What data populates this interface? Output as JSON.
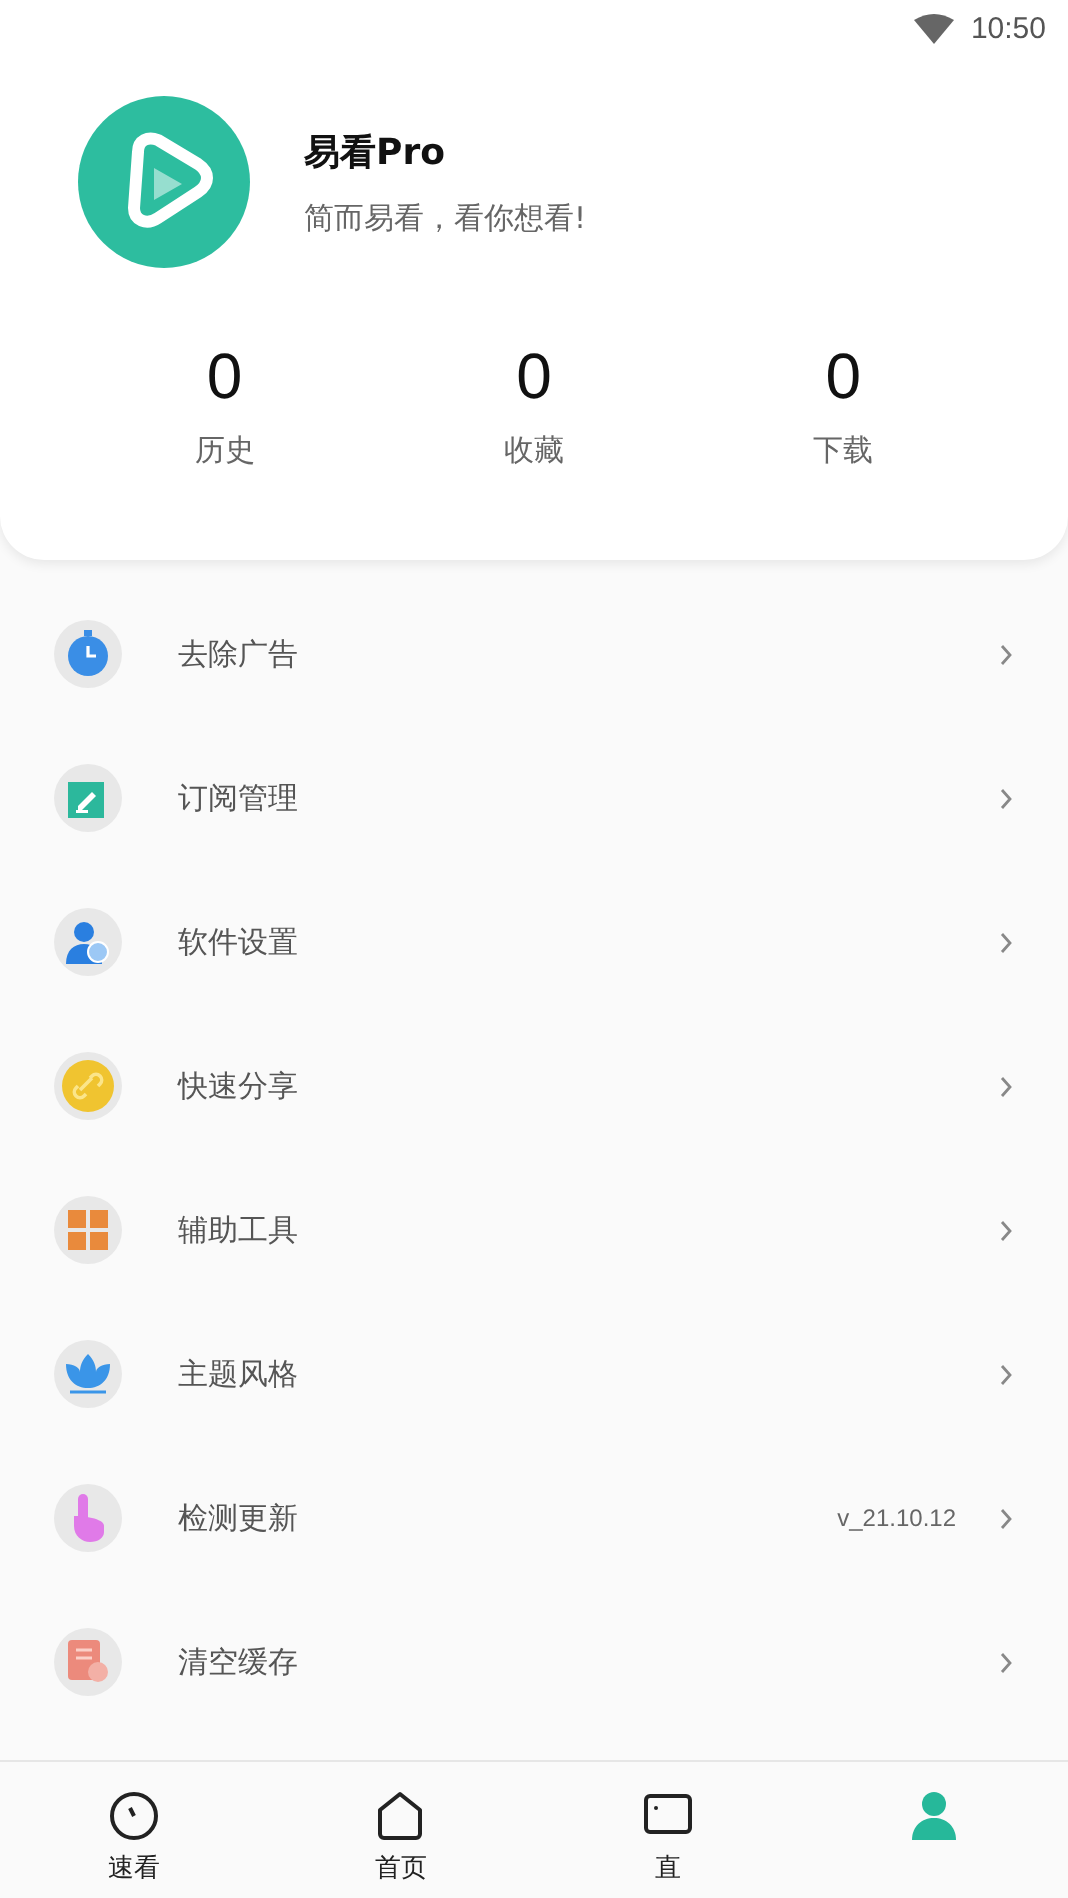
{
  "status_bar": {
    "time": "10:50"
  },
  "profile": {
    "name": "易看Pro",
    "slogan": "简而易看，看你想看!"
  },
  "stats": [
    {
      "value": "0",
      "label": "历史"
    },
    {
      "value": "0",
      "label": "收藏"
    },
    {
      "value": "0",
      "label": "下载"
    }
  ],
  "menu": [
    {
      "label": "去除广告"
    },
    {
      "label": "订阅管理"
    },
    {
      "label": "软件设置"
    },
    {
      "label": "快速分享"
    },
    {
      "label": "辅助工具"
    },
    {
      "label": "主题风格"
    },
    {
      "label": "检测更新",
      "value": "v_21.10.12"
    },
    {
      "label": "清空缓存"
    }
  ],
  "bottom_nav": [
    {
      "label": "速看",
      "selected": false
    },
    {
      "label": "首页",
      "selected": false
    },
    {
      "label": "直",
      "selected": false
    },
    {
      "selected": true
    }
  ]
}
